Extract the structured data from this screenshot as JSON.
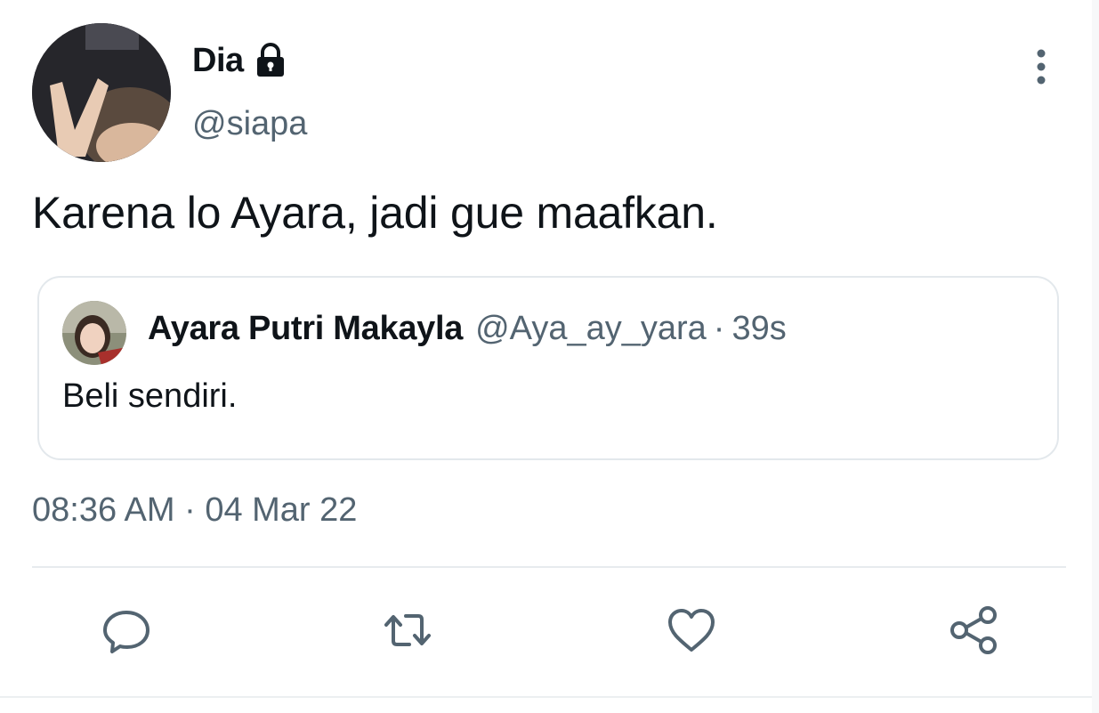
{
  "author": {
    "display_name": "Dia",
    "handle": "@siapa",
    "protected": true
  },
  "tweet": {
    "text": "Karena lo Ayara, jadi gue maafkan."
  },
  "quoted": {
    "display_name": "Ayara Putri Makayla",
    "handle": "@Aya_ay_yara",
    "separator": "·",
    "time": "39s",
    "text": "Beli sendiri."
  },
  "timestamp": "08:36 AM · 04 Mar 22",
  "actions": {
    "reply_icon": "reply-icon",
    "retweet_icon": "retweet-icon",
    "like_icon": "heart-icon",
    "share_icon": "share-icon"
  },
  "colors": {
    "text_primary": "#0f1419",
    "text_secondary": "#536471",
    "border": "#e3e8ec"
  }
}
